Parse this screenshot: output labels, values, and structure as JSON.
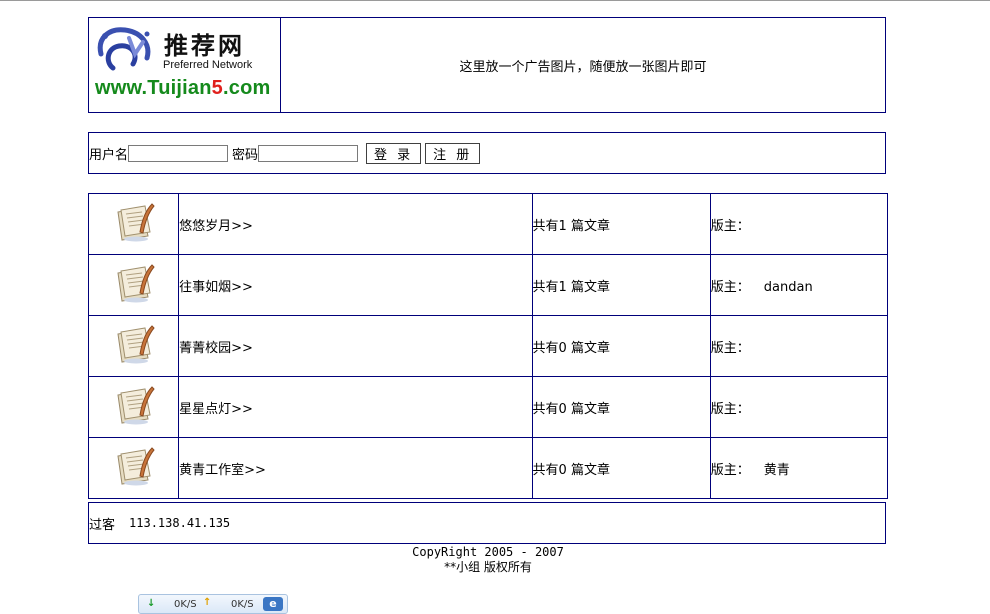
{
  "header": {
    "logo_cn": "推荐网",
    "logo_en": "Preferred Network",
    "logo_url_a": "www.Tuijian",
    "logo_url_b": "5",
    "logo_url_c": ".com",
    "ad_text": "这里放一个广告图片，随便放一张图片即可"
  },
  "login": {
    "username_label": "用户名",
    "password_label": "密码",
    "username_value": "",
    "password_value": "",
    "login_button": "登 录",
    "register_button": "注 册"
  },
  "forums": [
    {
      "name": "悠悠岁月>>",
      "count": "共有1 篇文章",
      "moderator_label": "版主：",
      "moderator": ""
    },
    {
      "name": "往事如烟>>",
      "count": "共有1 篇文章",
      "moderator_label": "版主：",
      "moderator": "dandan"
    },
    {
      "name": "菁菁校园>>",
      "count": "共有0 篇文章",
      "moderator_label": "版主：",
      "moderator": ""
    },
    {
      "name": "星星点灯>>",
      "count": "共有0 篇文章",
      "moderator_label": "版主：",
      "moderator": ""
    },
    {
      "name": "黄青工作室>>",
      "count": "共有0 篇文章",
      "moderator_label": "版主：",
      "moderator": "黄青"
    }
  ],
  "visitor": {
    "label": "过客",
    "ip": "113.138.41.135"
  },
  "footer": {
    "copyright": "CopyRight 2005 - 2007",
    "owner": "**小组 版权所有"
  },
  "status_widget": {
    "down_speed": "0K/S",
    "up_speed": "0K/S",
    "icon": "ie-icon"
  },
  "colors": {
    "border": "#00007a",
    "logo_green": "#158a1c",
    "logo_red": "#e0201c"
  }
}
